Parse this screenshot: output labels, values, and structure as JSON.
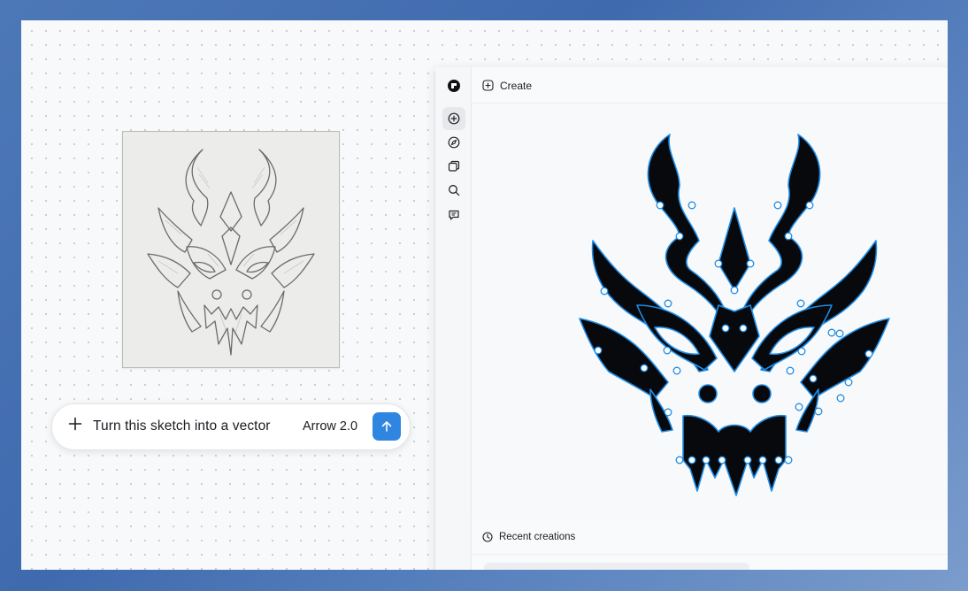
{
  "prompt": {
    "text": "Turn this sketch into a vector",
    "model": "Arrow 2.0",
    "add_icon": "plus-icon",
    "send_icon": "arrow-up-icon",
    "send_color": "#2f86e0"
  },
  "sketch": {
    "image": "pencil-sketch-demon-mask"
  },
  "app": {
    "rail_icons": [
      "app-logo-icon",
      "create-icon",
      "explore-icon",
      "gallery-icon",
      "search-icon",
      "chat-icon"
    ],
    "header": {
      "label": "Create",
      "icon": "plus-circle-icon"
    },
    "recent": {
      "label": "Recent creations",
      "icon": "clock-icon"
    },
    "vector": {
      "image": "vector-demon-mask",
      "fill": "#07090c",
      "stroke": "#1e8ce6",
      "node_color": "#ffffff"
    }
  }
}
